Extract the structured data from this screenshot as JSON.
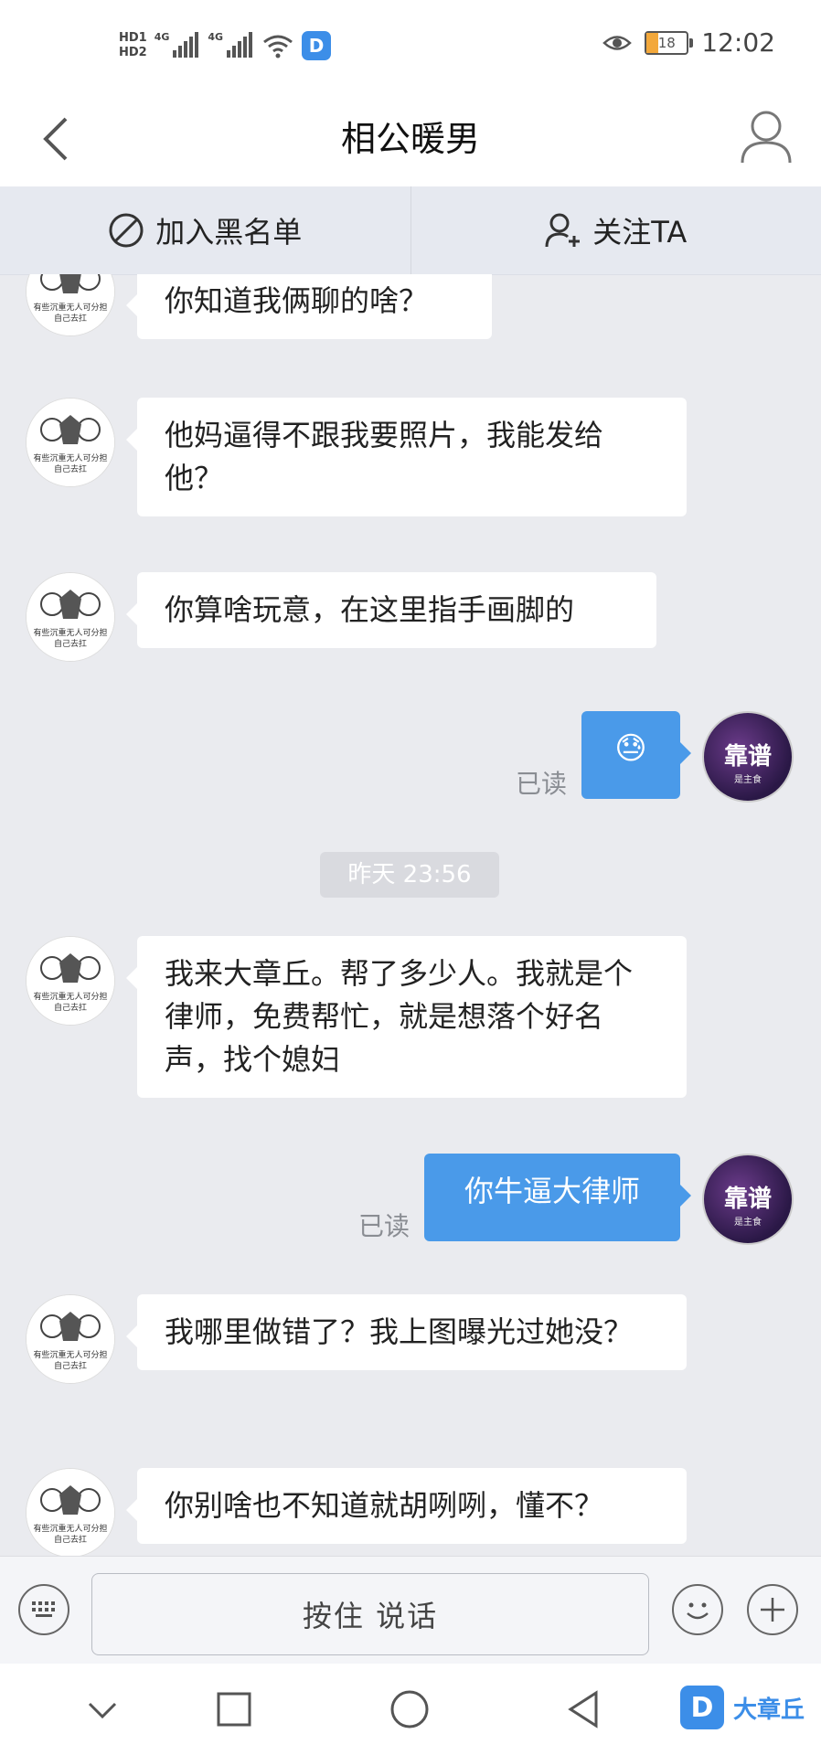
{
  "status": {
    "hd1": "HD1",
    "hd2": "HD2",
    "net1": "4G",
    "net2": "4G",
    "app_badge": "D",
    "battery": "18",
    "time": "12:02"
  },
  "header": {
    "title": "相公暖男"
  },
  "actions": {
    "blacklist_label": "加入黑名单",
    "follow_label": "关注TA"
  },
  "messages": [
    {
      "side": "in",
      "text": "你知道我俩聊的啥？"
    },
    {
      "side": "in",
      "text": "他妈逼得不跟我要照片，我能发给他？"
    },
    {
      "side": "in",
      "text": "你算啥玩意，在这里指手画脚的"
    },
    {
      "side": "out",
      "emoji": "😓",
      "read_label": "已读"
    },
    {
      "side": "in",
      "text": "我来大章丘。帮了多少人。我就是个律师，免费帮忙，就是想落个好名声，找个媳妇"
    },
    {
      "side": "out",
      "text": "你牛逼大律师",
      "read_label": "已读"
    },
    {
      "side": "in",
      "text": "我哪里做错了？我上图曝光过她没？"
    },
    {
      "side": "in",
      "text": "你别啥也不知道就胡咧咧，懂不？"
    }
  ],
  "timestamp": "昨天 23:56",
  "avatars": {
    "left_caption_1": "有些沉重无人可分担",
    "left_caption_2": "自己去扛",
    "right_caption_1": "靠谱",
    "right_caption_2": "是主食"
  },
  "input": {
    "voice_label": "按住 说话"
  },
  "watermark": {
    "logo": "D",
    "text": "大章丘"
  },
  "colors": {
    "accent_blue": "#4a9ae9",
    "chat_bg": "#eaebef"
  }
}
